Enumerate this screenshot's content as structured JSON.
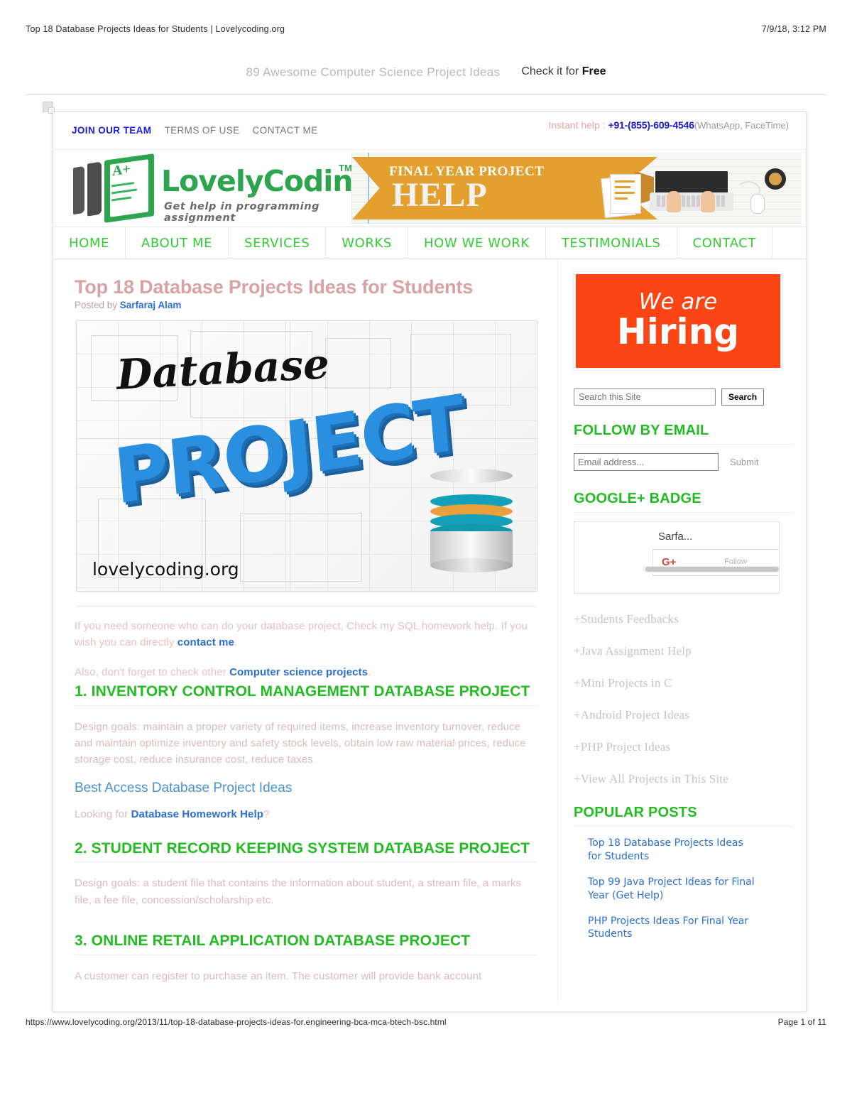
{
  "print": {
    "title": "Top 18 Database Projects Ideas for Students | Lovelycoding.org",
    "timestamp": "7/9/18, 3:12 PM",
    "url": "https://www.lovelycoding.org/2013/11/top-18-database-projects-ideas-for.engineering-bca-mca-btech-bsc.html",
    "page": "Page 1 of 11"
  },
  "promo": {
    "text": "89 Awesome Computer Science Project Ideas",
    "cta_prefix": "Check it for ",
    "cta_strong": "Free"
  },
  "utility": {
    "links": [
      {
        "label": "JOIN OUR TEAM"
      },
      {
        "label": "TERMS OF USE"
      },
      {
        "label": "CONTACT ME"
      }
    ],
    "instant_help_label": "Instant help : ",
    "instant_help_number": "+91-(855)-609-4546",
    "instant_help_note": "(WhatsApp, FaceTime)"
  },
  "brand": {
    "name": "LovelyCoding",
    "tm": "TM",
    "tagline": "Get help in programming assignment",
    "logo_grade": "A+"
  },
  "ad": {
    "line1": "FINAL YEAR PROJECT",
    "line2": "HELP"
  },
  "nav": {
    "items": [
      {
        "label": "HOME"
      },
      {
        "label": "ABOUT ME"
      },
      {
        "label": "SERVICES"
      },
      {
        "label": "WORKS"
      },
      {
        "label": "HOW WE WORK"
      },
      {
        "label": "TESTIMONIALS"
      },
      {
        "label": "CONTACT"
      }
    ]
  },
  "post": {
    "title": "Top 18 Database Projects Ideas for Students",
    "posted_by_label": "Posted by ",
    "author": "Sarfaraj Alam",
    "hero": {
      "script_word": "Database",
      "big_word": "PROJECT",
      "watermark": "lovelycoding.org"
    },
    "intro_1_a": "If you need someone who can do your database project, Check my SQL homework help. If you wish you can directly ",
    "intro_1_link": "contact me",
    "intro_1_b": ".",
    "intro_2_a": "Also, don't forget to check other ",
    "intro_2_link": "Computer science projects",
    "intro_2_b": ".",
    "sections": [
      {
        "heading": "1. INVENTORY CONTROL MANAGEMENT DATABASE PROJECT",
        "body": "Design goals: maintain a proper variety of required items, increase inventory turnover, reduce and maintain optimize inventory and safety stock levels, obtain low raw material prices, reduce storage cost, reduce insurance cost, reduce taxes",
        "subheading": "Best Access Database Project Ideas",
        "looking_prefix": "Looking for ",
        "looking_link": "Database Homework Help",
        "looking_suffix": "?"
      },
      {
        "heading": "2. STUDENT RECORD KEEPING SYSTEM DATABASE PROJECT",
        "body": "Design goals: a student file that contains the information about student, a stream file, a marks file, a fee file, concession/scholarship etc."
      },
      {
        "heading": "3. ONLINE RETAIL APPLICATION DATABASE PROJECT",
        "body": "A customer can register to purchase an item. The customer will provide bank account"
      }
    ]
  },
  "sidebar": {
    "hiring": {
      "line1": "We are",
      "line2": "Hiring"
    },
    "search": {
      "placeholder": "Search this Site",
      "button": "Search"
    },
    "follow": {
      "title": "FOLLOW BY EMAIL",
      "placeholder": "Email address...",
      "submit": "Submit"
    },
    "google_badge": {
      "title": "GOOGLE+ BADGE",
      "name": "Sarfa...",
      "g_icon": "G+",
      "follow": "Follow"
    },
    "plus_links": [
      {
        "label": "+Students Feedbacks"
      },
      {
        "label": "+Java Assignment Help"
      },
      {
        "label": "+Mini Projects in C"
      },
      {
        "label": "+Android Project Ideas"
      },
      {
        "label": "+PHP Project Ideas"
      },
      {
        "label": "+View All Projects in This Site"
      }
    ],
    "popular": {
      "title": "POPULAR POSTS",
      "items": [
        {
          "label": "Top 18 Database Projects Ideas for Students"
        },
        {
          "label": "Top 99 Java Project Ideas for Final Year (Get Help)"
        },
        {
          "label": "PHP Projects Ideas For Final Year Students"
        }
      ]
    }
  },
  "colors": {
    "brand_green": "#2da44e",
    "heading_green": "#22bb22",
    "link_blue": "#2a6fd6",
    "title_pink": "#d9a3a3",
    "hiring_orange": "#fb4515",
    "ad_orange": "#e3a02e"
  }
}
